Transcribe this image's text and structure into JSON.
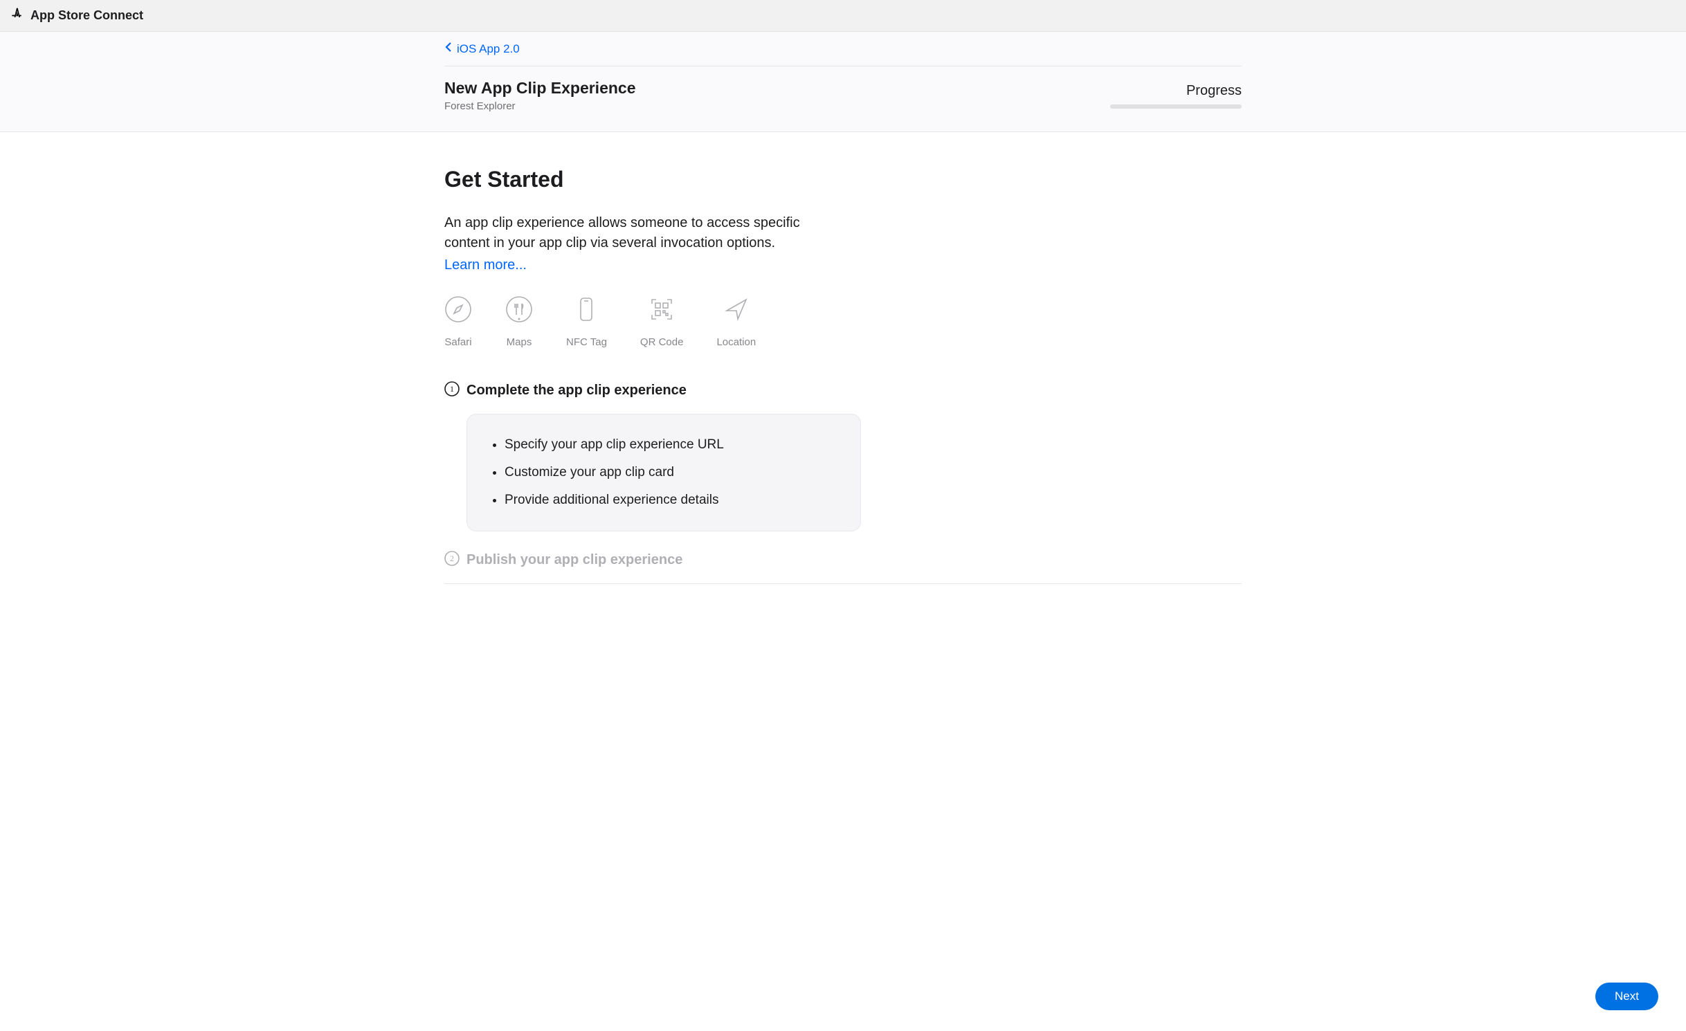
{
  "topbar": {
    "title": "App Store Connect"
  },
  "header": {
    "back_label": "iOS App 2.0",
    "page_title": "New App Clip Experience",
    "page_subtitle": "Forest Explorer",
    "progress_label": "Progress"
  },
  "main": {
    "heading": "Get Started",
    "intro": "An app clip experience allows someone to access specific content in your app clip via several invocation options.",
    "learn_more": "Learn more...",
    "invocations": [
      {
        "label": "Safari",
        "icon": "compass"
      },
      {
        "label": "Maps",
        "icon": "utensils"
      },
      {
        "label": "NFC Tag",
        "icon": "phone"
      },
      {
        "label": "QR Code",
        "icon": "qr"
      },
      {
        "label": "Location",
        "icon": "arrow"
      }
    ],
    "steps": [
      {
        "num": "1",
        "title": "Complete the app clip experience",
        "active": true,
        "tasks": [
          "Specify your app clip experience URL",
          "Customize your app clip card",
          "Provide additional experience details"
        ]
      },
      {
        "num": "2",
        "title": "Publish your app clip experience",
        "active": false
      }
    ]
  },
  "footer": {
    "next_label": "Next"
  }
}
